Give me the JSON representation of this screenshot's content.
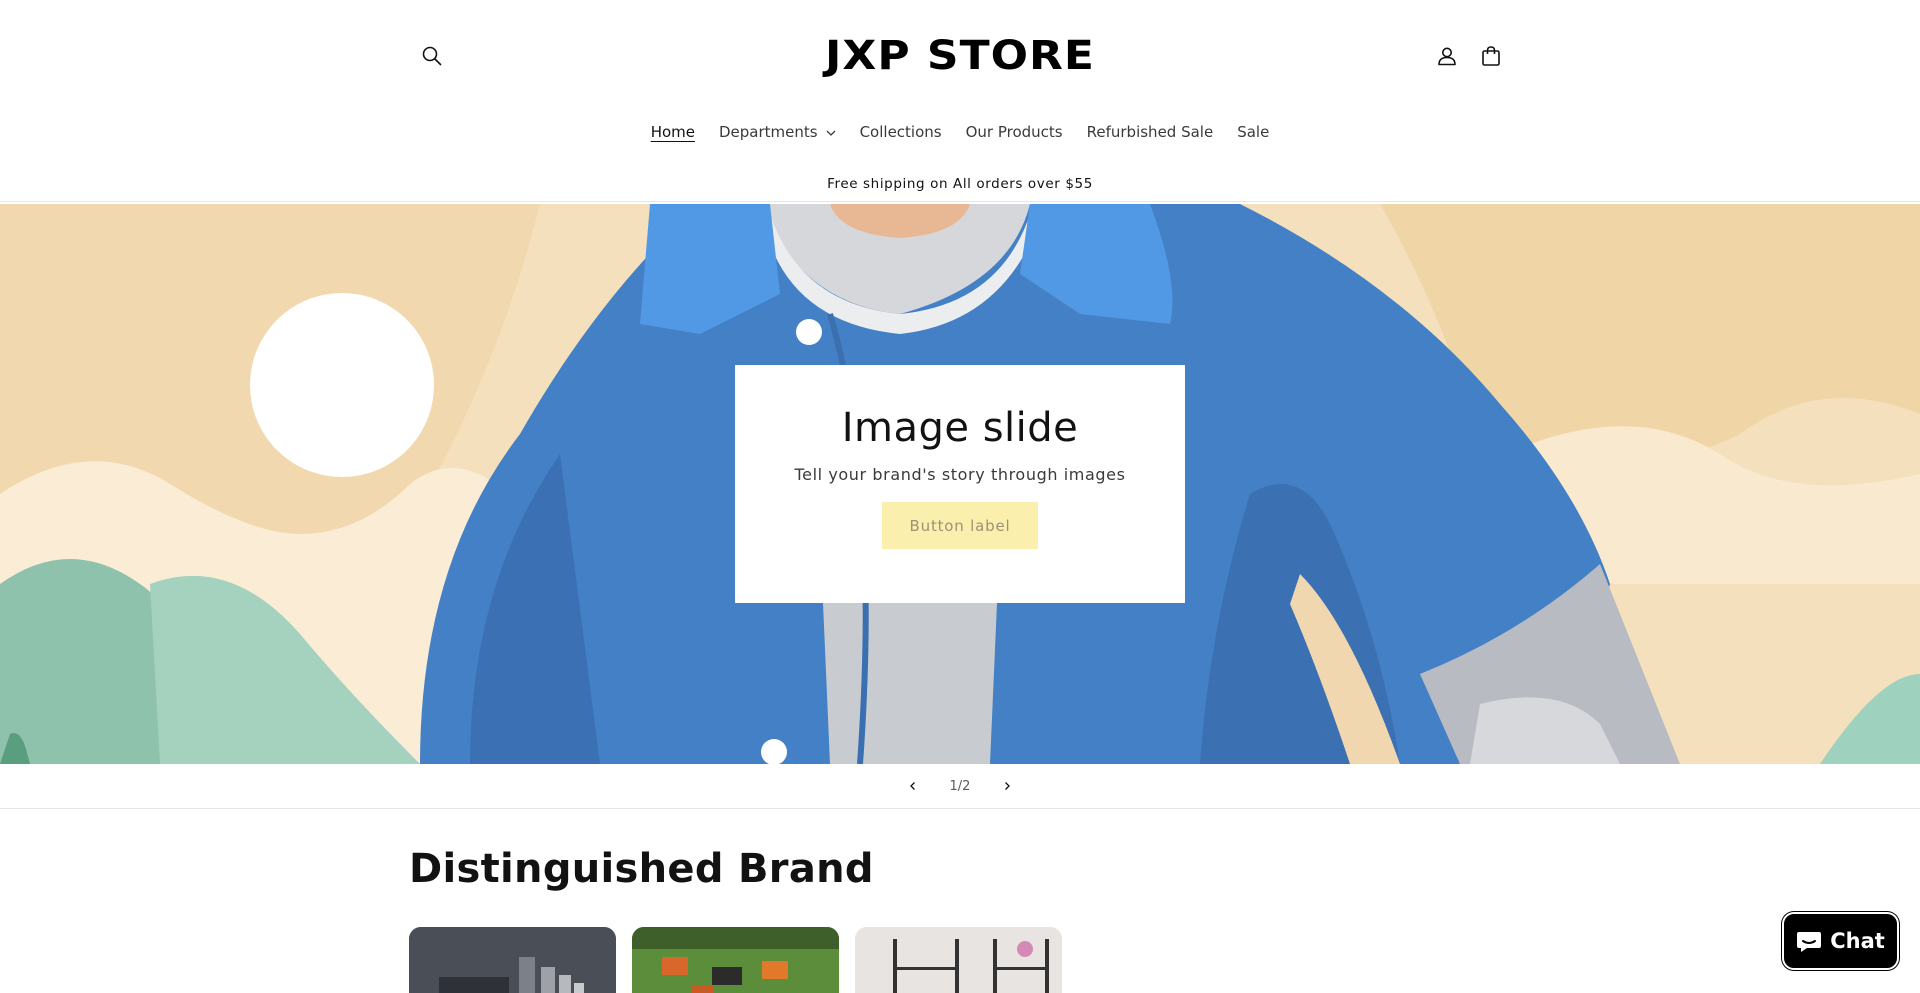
{
  "header": {
    "logo_text": "JXP STORE",
    "icons": [
      "search-icon",
      "account-icon",
      "cart-icon"
    ]
  },
  "nav": {
    "items": [
      {
        "label": "Home",
        "active": true
      },
      {
        "label": "Departments",
        "has_dropdown": true
      },
      {
        "label": "Collections"
      },
      {
        "label": "Our Products"
      },
      {
        "label": "Refurbished Sale"
      },
      {
        "label": "Sale"
      }
    ]
  },
  "announcement": {
    "text": "Free shipping on All orders over $55"
  },
  "hero": {
    "title": "Image slide",
    "subtitle": "Tell your brand's story through images",
    "button_label": "Button label",
    "button_color": "#fbefad",
    "background_color": "#f4e0bd"
  },
  "slider": {
    "counter": "1/2",
    "prev_icon": "chevron-left-icon",
    "next_icon": "chevron-right-icon"
  },
  "section": {
    "title": "Distinguished Brand"
  },
  "chat": {
    "label": "Chat",
    "icon": "chat-bubble-icon"
  }
}
